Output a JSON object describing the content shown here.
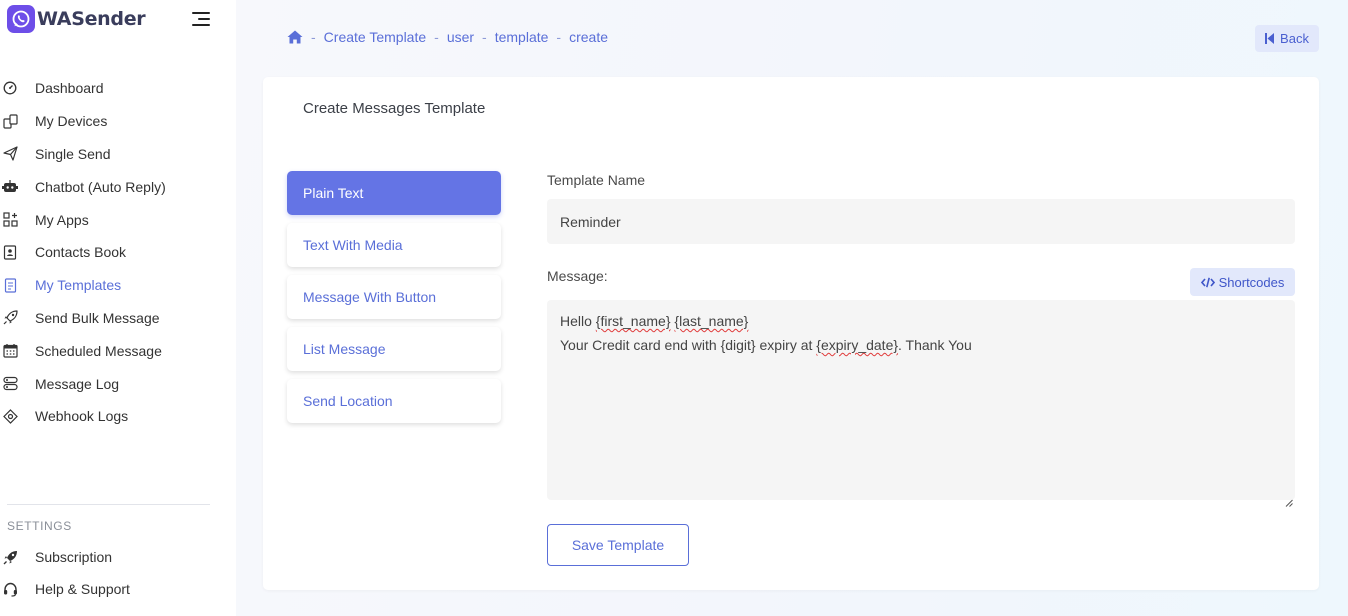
{
  "brand": {
    "name": "WASender",
    "logo_icon": "whatsapp-icon"
  },
  "sidebar": {
    "items": [
      {
        "label": "Dashboard",
        "icon": "gauge-icon",
        "active": false
      },
      {
        "label": "My Devices",
        "icon": "devices-icon",
        "active": false
      },
      {
        "label": "Single Send",
        "icon": "send-icon",
        "active": false
      },
      {
        "label": "Chatbot (Auto Reply)",
        "icon": "robot-icon",
        "active": false
      },
      {
        "label": "My Apps",
        "icon": "apps-icon",
        "active": false
      },
      {
        "label": "Contacts Book",
        "icon": "contacts-book-icon",
        "active": false
      },
      {
        "label": "My Templates",
        "icon": "templates-icon",
        "active": true
      },
      {
        "label": "Send Bulk Message",
        "icon": "rocket-icon",
        "active": false
      },
      {
        "label": "Scheduled Message",
        "icon": "calendar-icon",
        "active": false
      },
      {
        "label": "Message Log",
        "icon": "log-icon",
        "active": false
      },
      {
        "label": "Webhook Logs",
        "icon": "webhook-icon",
        "active": false
      }
    ],
    "settings_heading": "SETTINGS",
    "settings_items": [
      {
        "label": "Subscription",
        "icon": "subscription-rocket-icon"
      },
      {
        "label": "Help & Support",
        "icon": "headset-icon"
      }
    ]
  },
  "breadcrumb": {
    "items": [
      "Create Template",
      "user",
      "template",
      "create"
    ],
    "separator": "-"
  },
  "back_label": "Back",
  "card": {
    "title": "Create Messages Template",
    "tabs": [
      {
        "label": "Plain Text",
        "active": true
      },
      {
        "label": "Text With Media",
        "active": false
      },
      {
        "label": "Message With Button",
        "active": false
      },
      {
        "label": "List Message",
        "active": false
      },
      {
        "label": "Send Location",
        "active": false
      }
    ],
    "form": {
      "template_name_label": "Template Name",
      "template_name_value": "Reminder",
      "message_label": "Message:",
      "shortcodes_label": "Shortcodes",
      "message_lines": {
        "line1_a": "Hello ",
        "line1_b": "{first_name}",
        "line1_c": " ",
        "line1_d": "{last_name}",
        "line2_a": "Your Credit card end with {digit} expiry at ",
        "line2_b": "{expiry_date}",
        "line2_c": ". Thank You"
      },
      "save_label": "Save Template"
    }
  },
  "colors": {
    "accent": "#5a6fd8",
    "active_tab": "#6474e5",
    "brand": "#6d4ee8"
  }
}
